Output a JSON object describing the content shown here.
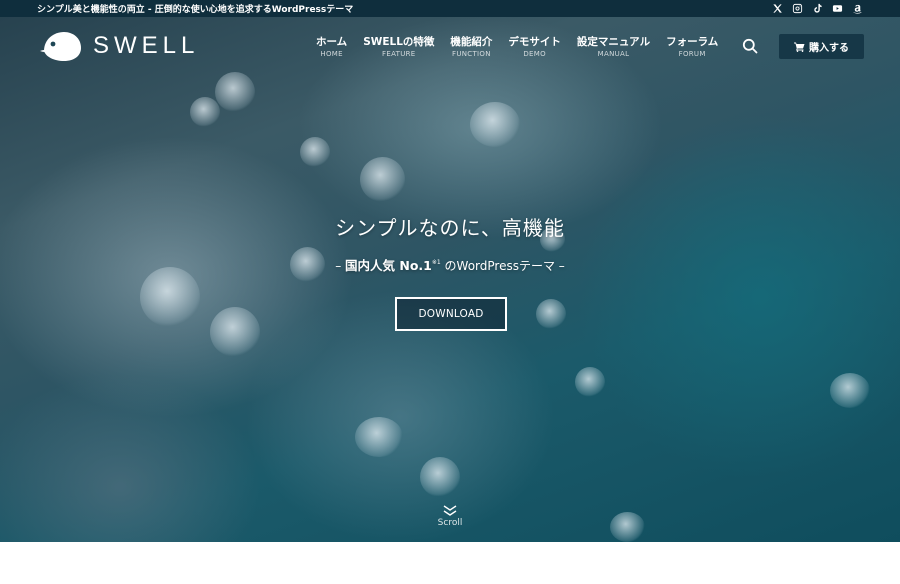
{
  "topbar": {
    "tagline": "シンプル美と機能性の両立 - 圧倒的な使い心地を追求するWordPressテーマ",
    "social_icons": [
      "x-icon",
      "instagram-icon",
      "tiktok-icon",
      "youtube-icon",
      "amazon-icon"
    ]
  },
  "header": {
    "logo_text": "SWELL",
    "nav": [
      {
        "label": "ホーム",
        "sub": "HOME"
      },
      {
        "label": "SWELLの特徴",
        "sub": "FEATURE"
      },
      {
        "label": "機能紹介",
        "sub": "FUNCTION"
      },
      {
        "label": "デモサイト",
        "sub": "DEMO"
      },
      {
        "label": "設定マニュアル",
        "sub": "MANUAL"
      },
      {
        "label": "フォーラム",
        "sub": "FORUM"
      }
    ],
    "search_icon": "search-icon",
    "cart_label": "購入する",
    "cart_icon": "cart-icon"
  },
  "hero": {
    "title": "シンプルなのに、高機能",
    "sub_prefix": "– ",
    "sub_strong": "国内人気 No.1",
    "sub_sup": "※1",
    "sub_suffix": " のWordPressテーマ –",
    "download_label": "DOWNLOAD",
    "scroll_label": "Scroll"
  },
  "colors": {
    "topbar_bg": "#0f2e3d",
    "cart_bg": "#163747",
    "hero_tint": "#1b5a6a"
  }
}
